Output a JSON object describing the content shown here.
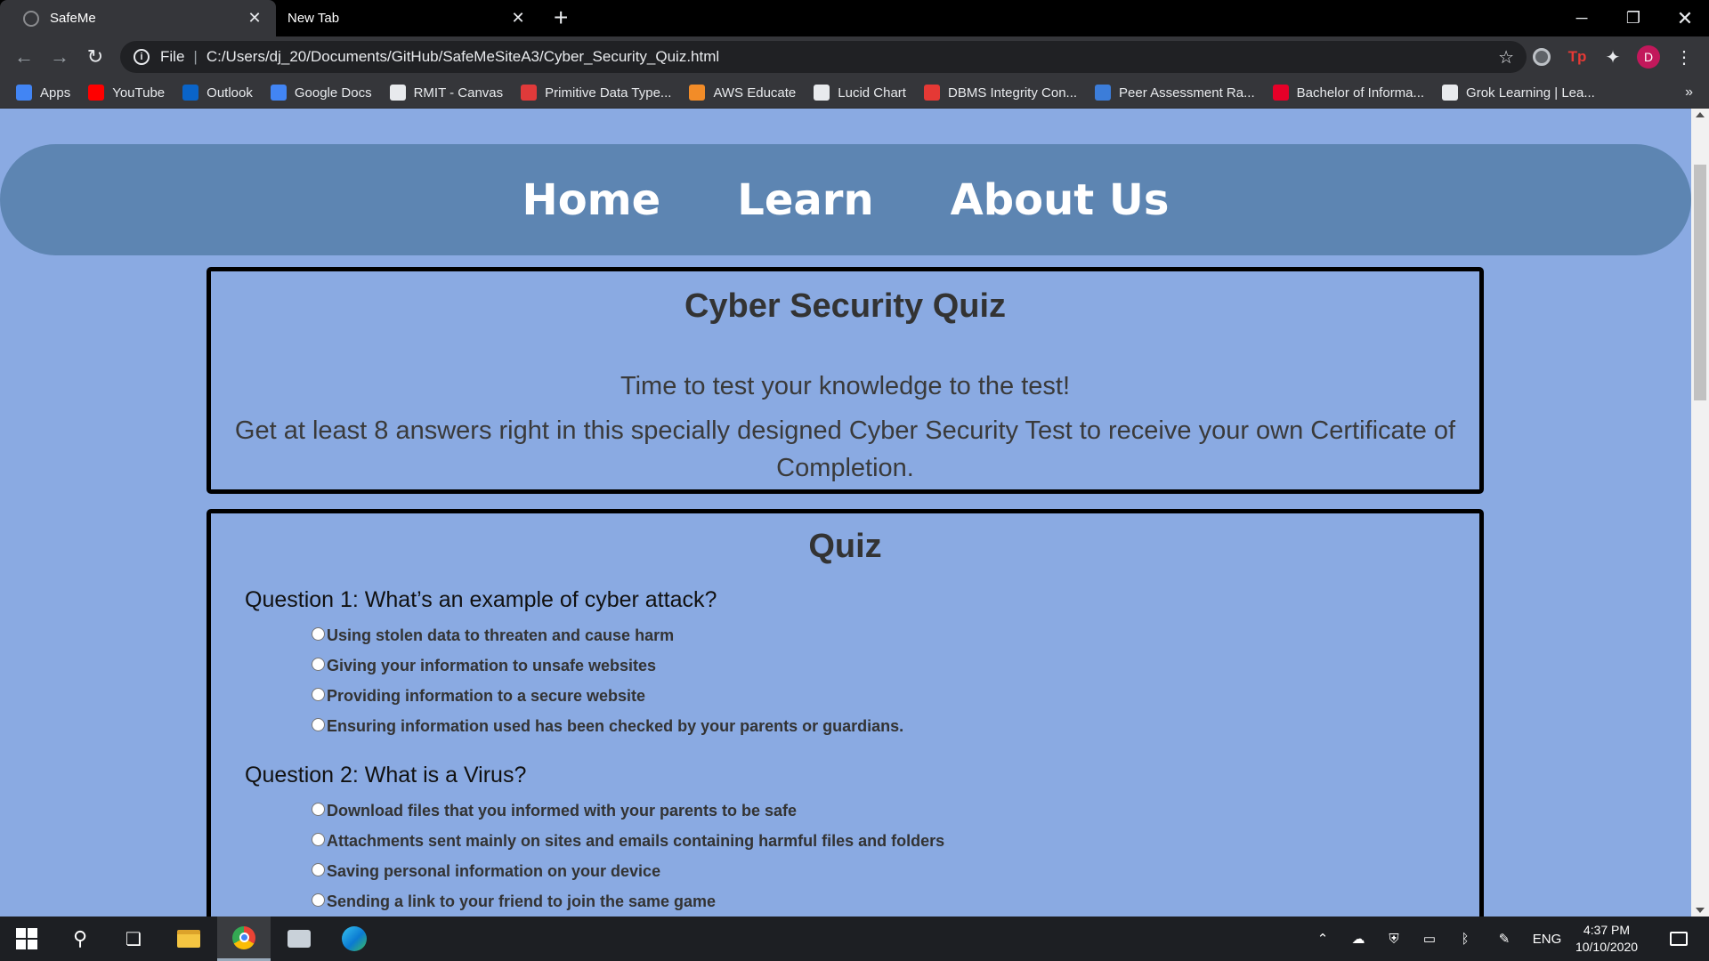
{
  "browser": {
    "tabs": [
      {
        "title": "SafeMe",
        "active": true
      },
      {
        "title": "New Tab",
        "active": false
      }
    ],
    "new_tab_icon": "plus-icon",
    "window_controls": {
      "minimize": "─",
      "maximize": "❐",
      "close": "✕"
    },
    "omnibox": {
      "scheme_label": "File",
      "url": "C:/Users/dj_20/Documents/GitHub/SafeMeSiteA3/Cyber_Security_Quiz.html"
    },
    "profile_initial": "D",
    "extension_tp": "Tp",
    "bookmarks": [
      {
        "label": "Apps",
        "icon": "apps-grid-icon",
        "color": "#4285f4"
      },
      {
        "label": "YouTube",
        "icon": "youtube-icon",
        "color": "#ff0000"
      },
      {
        "label": "Outlook",
        "icon": "outlook-icon",
        "color": "#0a64c8"
      },
      {
        "label": "Google Docs",
        "icon": "docs-icon",
        "color": "#4285f4"
      },
      {
        "label": "RMIT - Canvas",
        "icon": "canvas-icon",
        "color": "#e8eaed"
      },
      {
        "label": "Primitive Data Type...",
        "icon": "oracle-icon",
        "color": "#e03a3a"
      },
      {
        "label": "AWS Educate",
        "icon": "aws-icon",
        "color": "#f28c28"
      },
      {
        "label": "Lucid Chart",
        "icon": "lucid-icon",
        "color": "#e8eaed"
      },
      {
        "label": "DBMS Integrity Con...",
        "icon": "dbms-icon",
        "color": "#e53935"
      },
      {
        "label": "Peer Assessment Ra...",
        "icon": "peer-icon",
        "color": "#3c7dd9"
      },
      {
        "label": "Bachelor of Informa...",
        "icon": "rmit-icon",
        "color": "#e60028"
      },
      {
        "label": "Grok Learning | Lea...",
        "icon": "grok-icon",
        "color": "#e8eaed"
      }
    ],
    "bookmarks_overflow": "»"
  },
  "site": {
    "nav": [
      "Home",
      "Learn",
      "About Us"
    ],
    "intro": {
      "title": "Cyber Security Quiz",
      "line1": "Time to test your knowledge to the test!",
      "line2": "Get at least 8 answers right in this specially designed Cyber Security Test to receive your own Certificate of Completion."
    },
    "quiz": {
      "heading": "Quiz",
      "questions": [
        {
          "text": "Question 1: What’s an example of cyber attack?",
          "options": [
            "Using stolen data to threaten and cause harm",
            "Giving your information to unsafe websites",
            "Providing information to a secure website",
            "Ensuring information used has been checked by your parents or guardians."
          ]
        },
        {
          "text": "Question 2: What is a Virus?",
          "options": [
            "Download files that you informed with your parents to be safe",
            "Attachments sent mainly on sites and emails containing harmful files and folders",
            "Saving personal information on your device",
            "Sending a link to your friend to join the same game"
          ]
        }
      ]
    }
  },
  "taskbar": {
    "language": "ENG",
    "time": "4:37 PM",
    "date": "10/10/2020"
  }
}
